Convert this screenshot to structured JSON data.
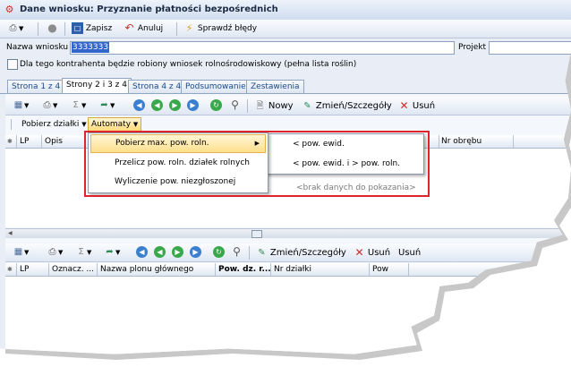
{
  "window": {
    "title": "Dane wniosku: Przyznanie płatności bezpośrednich"
  },
  "toolbar": {
    "save_label": "Zapisz",
    "cancel_label": "Anuluj",
    "check_label": "Sprawdź błędy"
  },
  "form": {
    "name_label": "Nazwa wniosku",
    "name_value": "3333333",
    "project_label": "Projekt",
    "checkbox_label": "Dla tego kontrahenta będzie robiony wniosek rolnośrodowiskowy (pełna lista roślin)",
    "checkbox_checked": false
  },
  "tabs": [
    {
      "label": "Strona 1 z 4",
      "active": false
    },
    {
      "label": "Strony 2 i 3 z 4",
      "active": true
    },
    {
      "label": "Strona 4 z 4",
      "active": false
    },
    {
      "label": "Podsumowanie",
      "active": false
    },
    {
      "label": "Zestawienia",
      "active": false
    }
  ],
  "grid_toolbar": {
    "new_label": "Nowy",
    "edit_label": "Zmień/Szczegóły",
    "delete_label": "Usuń"
  },
  "action_bar": {
    "fetch_label": "Pobierz działki",
    "automaty_label": "Automaty"
  },
  "upper_grid": {
    "columns": [
      "LP",
      "Opis",
      "Nr obrębu"
    ]
  },
  "menu": {
    "items": [
      "Pobierz max. pow. roln.",
      "Przelicz pow. roln. działek rolnych",
      "Wyliczenie pow. niezgłoszonej"
    ],
    "submenu": [
      "< pow. ewid.",
      "< pow. ewid. i > pow. roln."
    ]
  },
  "empty_text": "<brak danych do pokazania>",
  "lower_toolbar": {
    "edit_label": "Zmień/Szczegóły",
    "delete_label": "Usuń",
    "delete_label2": "Usuń"
  },
  "lower_grid": {
    "columns": [
      "LP",
      "Oznacz. ...",
      "Nazwa plonu głównego",
      "Pow. dz. r...",
      "Nr działki",
      "Pow"
    ]
  },
  "colors": {
    "accent": "#3266cc",
    "highlight": "#ffdf8c",
    "callout": "#e0242c"
  }
}
